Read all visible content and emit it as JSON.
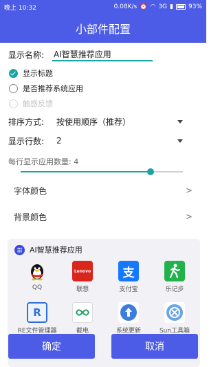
{
  "status_bar": {
    "time": "晚上 10:32",
    "speed": "0.08K/s",
    "network": "3G",
    "battery": "93%"
  },
  "title": "小部件配置",
  "display_name": {
    "label": "显示名称:",
    "value": "AI智慧推荐应用"
  },
  "checkboxes": [
    {
      "label": "显示标题",
      "checked": true,
      "disabled": false
    },
    {
      "label": "是否推荐系统应用",
      "checked": false,
      "disabled": false
    },
    {
      "label": "触感反馈",
      "checked": false,
      "disabled": true
    }
  ],
  "sort": {
    "label": "排序方式:",
    "value": "按使用顺序（推荐）"
  },
  "rows": {
    "label": "显示行数:",
    "value": "2"
  },
  "per_row": {
    "label": "每行显示应用数量: 4",
    "value": 4,
    "level_percent": 80
  },
  "font_color": {
    "label": "字体颜色",
    "chevron": ">"
  },
  "bg_color": {
    "label": "背景颜色",
    "chevron": ">"
  },
  "widget": {
    "title": "AI智慧推荐应用",
    "apps": [
      {
        "name": "QQ",
        "icon": "qq-penguin-icon",
        "color": "#000000"
      },
      {
        "name": "联想",
        "icon": "lenovo-icon",
        "color": "#d8261c",
        "icon_text": "Lenovo"
      },
      {
        "name": "支付宝",
        "icon": "alipay-icon",
        "color": "#1677ff",
        "icon_text": "支"
      },
      {
        "name": "乐记步",
        "icon": "walking-icon",
        "color": "#22b24c"
      },
      {
        "name": "RE文件管理器",
        "icon": "re-file-icon",
        "color": "#2f6fd6",
        "icon_text": "R"
      },
      {
        "name": "截电",
        "icon": "infinity-icon",
        "color": "#2aa36b"
      },
      {
        "name": "系统更新",
        "icon": "update-icon",
        "color": "#3e7de0"
      },
      {
        "name": "Sun工具箱",
        "icon": "sun-tools-icon",
        "color": "#6aa5e8"
      }
    ]
  },
  "buttons": {
    "confirm": "确定",
    "cancel": "取消"
  },
  "colors": {
    "primary": "#4d5ce6",
    "accent": "#1aa3a3"
  }
}
